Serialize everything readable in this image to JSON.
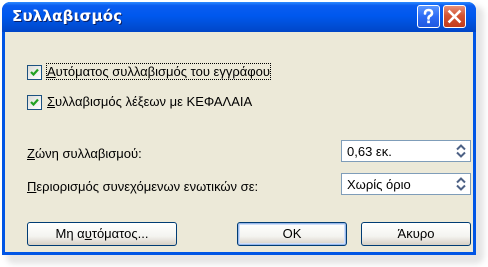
{
  "window": {
    "title": "Συλλαβισμός"
  },
  "options": {
    "auto_hyphenate": {
      "label_before": "",
      "label_key": "Α",
      "label_after": "υτόματος συλλαβισμός του εγγράφου",
      "checked": true
    },
    "hyphenate_caps": {
      "label_before": "",
      "label_key": "Σ",
      "label_after": "υλλαβισμός λέξεων με ΚΕΦΑΛΑΙΑ",
      "checked": true
    }
  },
  "zone": {
    "label_key": "Ζ",
    "label_after": "ώνη συλλαβισμού:",
    "value": "0,63 εκ."
  },
  "limit": {
    "label_key": "Π",
    "label_after": "εριορισμός συνεχόμενων ενωτικών σε:",
    "value": "Χωρίς όριο"
  },
  "buttons": {
    "manual_before": "Μη α",
    "manual_key": "υ",
    "manual_after": "τόματος...",
    "ok": "OK",
    "cancel": "Άκυρο"
  },
  "colors": {
    "title_bar": "#0058ee",
    "dialog_face": "#ece9d8",
    "close_button": "#d35433",
    "checkmark": "#21a121"
  },
  "icons": {
    "help": "question-mark-icon",
    "close": "close-x-icon",
    "spin": "spin-up-down-icon"
  }
}
